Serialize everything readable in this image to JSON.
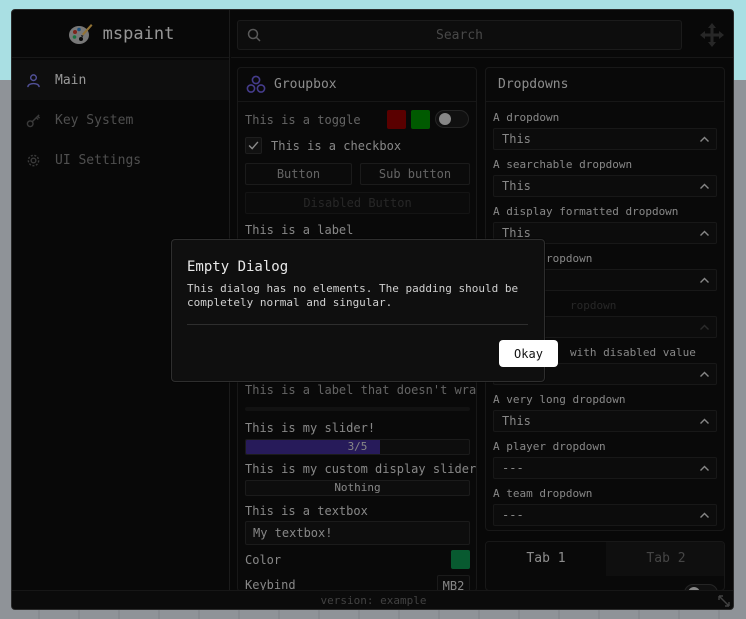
{
  "app": {
    "name": "mspaint",
    "version_text": "version: example"
  },
  "sidebar": {
    "items": [
      {
        "label": "Main",
        "icon": "user-icon",
        "active": true
      },
      {
        "label": "Key System",
        "icon": "key-icon",
        "active": false
      },
      {
        "label": "UI Settings",
        "icon": "gear-icon",
        "active": false
      }
    ]
  },
  "search": {
    "placeholder": "Search"
  },
  "groupbox": {
    "title": "Groupbox",
    "toggle_label": "This is a toggle",
    "swatch_colors": [
      "#8b0000",
      "#008a00"
    ],
    "checkbox_label": "This is a checkbox",
    "button_label": "Button",
    "sub_button_label": "Sub button",
    "disabled_button_label": "Disabled Button",
    "label_text": "This is a label",
    "label_nowrap": "This is a label that doesn't wrap",
    "slider_label": "This is my slider!",
    "slider_value_text": "3/5",
    "slider_value": 0.6,
    "custom_slider_label": "This is my custom display slider!",
    "custom_slider_value_text": "Nothing",
    "textbox_label": "This is a textbox",
    "textbox_value": "My textbox!",
    "color_label": "Color",
    "color_value": "#0d8a4a",
    "keybind_label": "Keybind",
    "keybind_value": "MB2"
  },
  "dropdowns": {
    "title": "Dropdowns",
    "items": [
      {
        "label": "A dropdown",
        "value": "This"
      },
      {
        "label": "A searchable dropdown",
        "value": "This"
      },
      {
        "label": "A display formatted dropdown",
        "value": "This"
      },
      {
        "label": "ropdown",
        "value": ""
      },
      {
        "label": "ropdown",
        "value": "",
        "disabled": true
      },
      {
        "label": "with disabled value",
        "value": ""
      },
      {
        "label": "A very long dropdown",
        "value": "This"
      },
      {
        "label": "A player dropdown",
        "value": "---"
      },
      {
        "label": "A team dropdown",
        "value": "---"
      }
    ]
  },
  "tabbox": {
    "tab1": "Tab 1",
    "tab2": "Tab 2"
  },
  "dialog": {
    "title": "Empty Dialog",
    "body": "This dialog has no elements. The padding should be completely normal and singular.",
    "ok_label": "Okay"
  }
}
